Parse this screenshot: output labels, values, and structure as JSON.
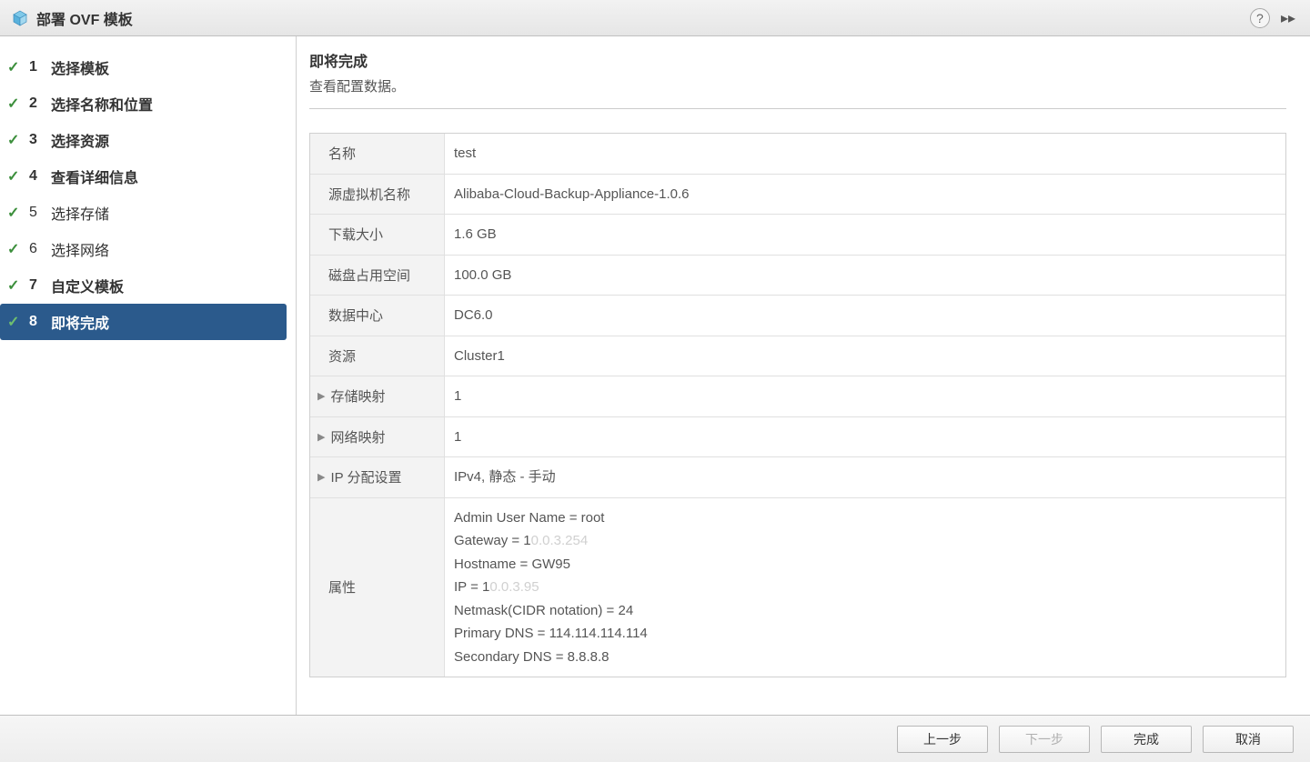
{
  "titlebar": {
    "title": "部署 OVF 模板"
  },
  "sidebar": {
    "steps": [
      {
        "num": "1",
        "label": "选择模板"
      },
      {
        "num": "2",
        "label": "选择名称和位置"
      },
      {
        "num": "3",
        "label": "选择资源"
      },
      {
        "num": "4",
        "label": "查看详细信息"
      },
      {
        "num": "5",
        "label": "选择存储"
      },
      {
        "num": "6",
        "label": "选择网络"
      },
      {
        "num": "7",
        "label": "自定义模板"
      },
      {
        "num": "8",
        "label": "即将完成"
      }
    ]
  },
  "content": {
    "heading": "即将完成",
    "subheading": "查看配置数据。",
    "rows": {
      "r0": {
        "key": "名称",
        "val": "test"
      },
      "r1": {
        "key": "源虚拟机名称",
        "val": "Alibaba-Cloud-Backup-Appliance-1.0.6"
      },
      "r2": {
        "key": "下载大小",
        "val": "1.6 GB"
      },
      "r3": {
        "key": "磁盘占用空间",
        "val": "100.0 GB"
      },
      "r4": {
        "key": "数据中心",
        "val": "DC6.0"
      },
      "r5": {
        "key": "资源",
        "val": "Cluster1"
      },
      "r6": {
        "key": "存储映射",
        "val": "1"
      },
      "r7": {
        "key": "网络映射",
        "val": "1"
      },
      "r8": {
        "key": "IP 分配设置",
        "val": "IPv4, 静态 - 手动"
      },
      "r9": {
        "key": "属性",
        "admin": "Admin User Name = root",
        "gateway_prefix": "Gateway = 1",
        "gateway_blur": "0.0.3.254",
        "hostname": "Hostname = GW95",
        "ip_prefix": "IP = 1",
        "ip_blur": "0.0.3.95",
        "netmask": "Netmask(CIDR notation) = 24",
        "primary_dns": "Primary DNS = 114.114.114.114",
        "secondary_dns": "Secondary DNS = 8.8.8.8"
      }
    }
  },
  "footer": {
    "back": "上一步",
    "next": "下一步",
    "finish": "完成",
    "cancel": "取消"
  }
}
